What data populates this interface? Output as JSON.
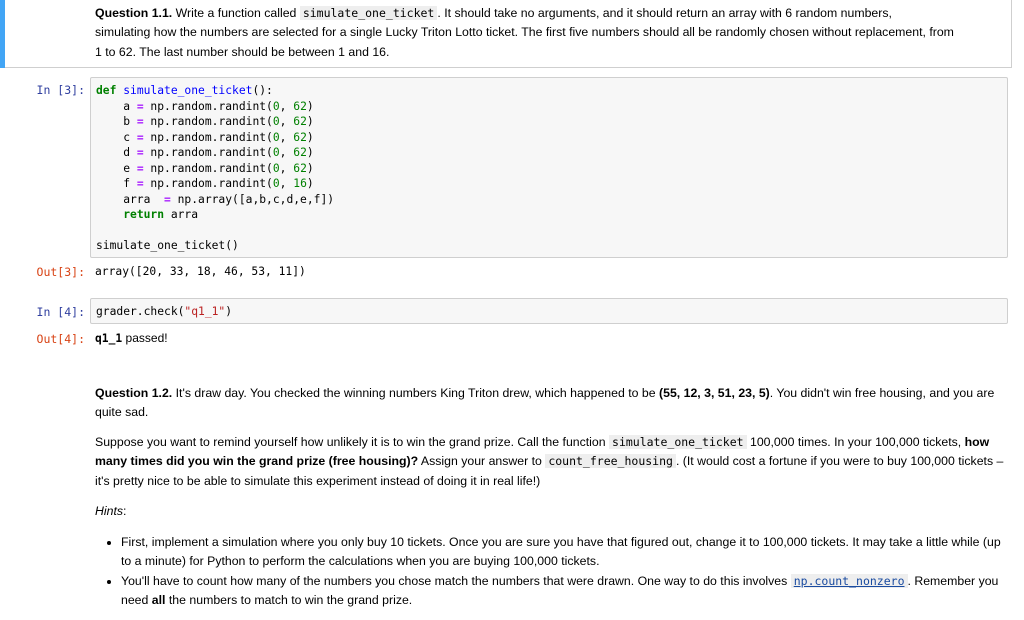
{
  "q11": {
    "label": "Question 1.1.",
    "t1": " Write a function called ",
    "code1": "simulate_one_ticket",
    "t2": ". It should take no arguments, and it should return an array with 6 random numbers,",
    "line2": "simulating how the numbers are selected for a single Lucky Triton Lotto ticket. The first five numbers should all be randomly chosen without replacement, from",
    "line3": "1 to 62. The last number should be between 1 and 16."
  },
  "cell3": {
    "in_prompt": "In [3]:",
    "out_prompt": "Out[3]:",
    "code_lines": [
      "def simulate_one_ticket():",
      "    a = np.random.randint(0, 62)",
      "    b = np.random.randint(0, 62)",
      "    c = np.random.randint(0, 62)",
      "    d = np.random.randint(0, 62)",
      "    e = np.random.randint(0, 62)",
      "    f = np.random.randint(0, 16)",
      "    arra  = np.array([a,b,c,d,e,f])",
      "    return arra",
      "",
      "simulate_one_ticket()"
    ],
    "output": "array([20, 33, 18, 46, 53, 11])"
  },
  "cell4": {
    "in_prompt": "In [4]:",
    "out_prompt": "Out[4]:",
    "code": "grader.check(\"q1_1\")",
    "output_code": "q1_1",
    "output_text": " passed!"
  },
  "q12": {
    "label": "Question 1.2.",
    "t1": " It's draw day. You checked the winning numbers King Triton drew, which happened to be ",
    "numbers": "(55, 12, 3, 51, 23, 5)",
    "t2": ". You didn't win free housing, and you are quite sad.",
    "p2_a": "Suppose you want to remind yourself how unlikely it is to win the grand prize. Call the function ",
    "p2_code1": "simulate_one_ticket",
    "p2_b": " 100,000 times. In your 100,000 tickets, ",
    "p2_bold": "how many times did you win the grand prize (free housing)?",
    "p2_c": " Assign your answer to ",
    "p2_code2": "count_free_housing",
    "p2_d": ". (It would cost a fortune if you were to buy 100,000 tickets – it's pretty nice to be able to simulate this experiment instead of doing it in real life!)",
    "hints_label": "Hints",
    "hints_colon": ":",
    "hint1": "First, implement a simulation where you only buy 10 tickets. Once you are sure you have that figured out, change it to 100,000 tickets. It may take a little while (up to a minute) for Python to perform the calculations when you are buying 100,000 tickets.",
    "hint2_a": "You'll have to count how many of the numbers you chose match the numbers that were drawn. One way to do this involves ",
    "hint2_code": "np.count_nonzero",
    "hint2_b": ". Remember you need ",
    "hint2_bold": "all",
    "hint2_c": " the numbers to match to win the grand prize."
  }
}
